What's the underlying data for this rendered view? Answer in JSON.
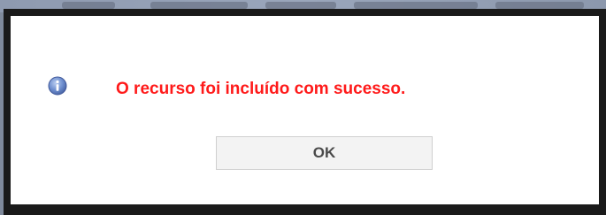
{
  "dialog": {
    "icon": "info-icon",
    "message": "O recurso foi incluído com sucesso.",
    "ok_label": "OK",
    "message_color": "#ff1a1a"
  }
}
